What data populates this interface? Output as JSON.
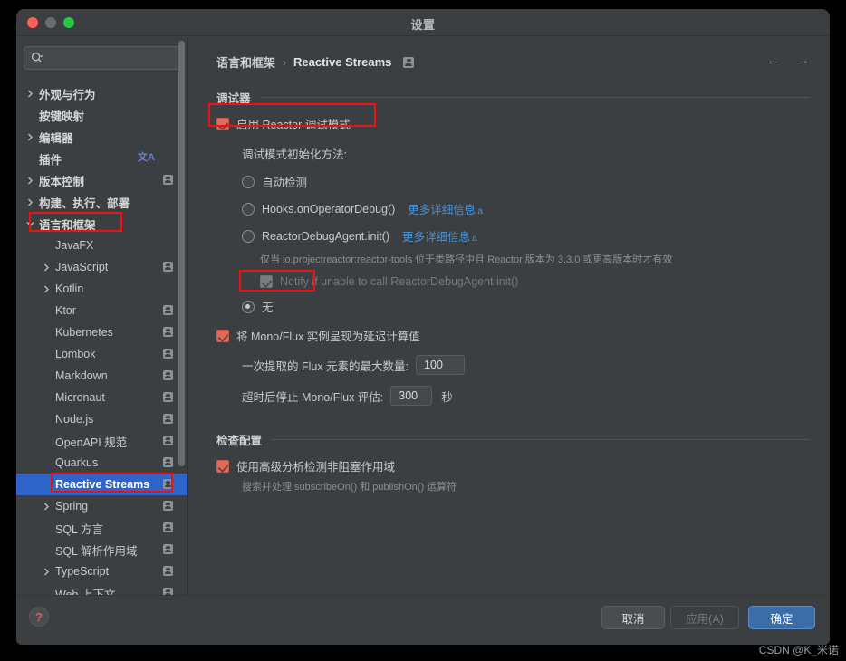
{
  "window": {
    "title": "设置",
    "traffic_lights": [
      "close",
      "minimize",
      "maximize"
    ]
  },
  "sidebar": {
    "search": {
      "value": "",
      "placeholder": ""
    },
    "items": [
      {
        "label": "外观与行为",
        "arrow": "collapsed",
        "indent": 0,
        "bold": true,
        "badge": "none"
      },
      {
        "label": "按键映射",
        "arrow": "none",
        "indent": 0,
        "bold": true,
        "badge": "none"
      },
      {
        "label": "编辑器",
        "arrow": "collapsed",
        "indent": 0,
        "bold": true,
        "badge": "none"
      },
      {
        "label": "插件",
        "arrow": "none",
        "indent": 0,
        "bold": true,
        "badge": "translate"
      },
      {
        "label": "版本控制",
        "arrow": "collapsed",
        "indent": 0,
        "bold": true,
        "badge": "project"
      },
      {
        "label": "构建、执行、部署",
        "arrow": "collapsed",
        "indent": 0,
        "bold": true,
        "badge": "none"
      },
      {
        "label": "语言和框架",
        "arrow": "expanded",
        "indent": 0,
        "bold": true,
        "badge": "none",
        "highlight": true
      },
      {
        "label": "JavaFX",
        "arrow": "none",
        "indent": 1,
        "bold": false,
        "badge": "none"
      },
      {
        "label": "JavaScript",
        "arrow": "collapsed",
        "indent": 1,
        "bold": false,
        "badge": "project"
      },
      {
        "label": "Kotlin",
        "arrow": "collapsed",
        "indent": 1,
        "bold": false,
        "badge": "none"
      },
      {
        "label": "Ktor",
        "arrow": "none",
        "indent": 1,
        "bold": false,
        "badge": "project"
      },
      {
        "label": "Kubernetes",
        "arrow": "none",
        "indent": 1,
        "bold": false,
        "badge": "project"
      },
      {
        "label": "Lombok",
        "arrow": "none",
        "indent": 1,
        "bold": false,
        "badge": "project"
      },
      {
        "label": "Markdown",
        "arrow": "none",
        "indent": 1,
        "bold": false,
        "badge": "project"
      },
      {
        "label": "Micronaut",
        "arrow": "none",
        "indent": 1,
        "bold": false,
        "badge": "project"
      },
      {
        "label": "Node.js",
        "arrow": "none",
        "indent": 1,
        "bold": false,
        "badge": "project"
      },
      {
        "label": "OpenAPI 规范",
        "arrow": "none",
        "indent": 1,
        "bold": false,
        "badge": "project"
      },
      {
        "label": "Quarkus",
        "arrow": "none",
        "indent": 1,
        "bold": false,
        "badge": "project"
      },
      {
        "label": "Reactive Streams",
        "arrow": "none",
        "indent": 1,
        "bold": false,
        "badge": "project",
        "selected": true,
        "highlight": true
      },
      {
        "label": "Spring",
        "arrow": "collapsed",
        "indent": 1,
        "bold": false,
        "badge": "project"
      },
      {
        "label": "SQL 方言",
        "arrow": "none",
        "indent": 1,
        "bold": false,
        "badge": "project"
      },
      {
        "label": "SQL 解析作用域",
        "arrow": "none",
        "indent": 1,
        "bold": false,
        "badge": "project"
      },
      {
        "label": "TypeScript",
        "arrow": "collapsed",
        "indent": 1,
        "bold": false,
        "badge": "project"
      },
      {
        "label": "Web 上下文",
        "arrow": "none",
        "indent": 1,
        "bold": false,
        "badge": "project"
      }
    ]
  },
  "main": {
    "breadcrumb": {
      "parent": "语言和框架",
      "separator": "›",
      "current": "Reactive Streams"
    },
    "nav": {
      "back": "←",
      "forward": "→"
    },
    "debugger_section": {
      "title": "调试器",
      "enable_checkbox": {
        "label": "启用 Reactor 调试模式",
        "checked": true,
        "highlight": true
      },
      "init_method_label": "调试模式初始化方法:",
      "options": [
        {
          "label": "自动检测",
          "selected": false,
          "link": null
        },
        {
          "label": "Hooks.onOperatorDebug()",
          "selected": false,
          "link": "更多详细信息"
        },
        {
          "label": "ReactorDebugAgent.init()",
          "selected": false,
          "link": "更多详细信息"
        }
      ],
      "agent_hint": "仅当 io.projectreactor:reactor-tools 位于类路径中且 Reactor 版本为 3.3.0 或更高版本时才有效",
      "notify_checkbox": {
        "label": "Notify if unable to call ReactorDebugAgent.init()",
        "checked": true,
        "disabled": true
      },
      "none_option": {
        "label": "无",
        "selected": true,
        "highlight": true
      },
      "lazy_checkbox": {
        "label": "将 Mono/Flux 实例呈现为延迟计算值",
        "checked": true
      },
      "max_flux_label": "一次提取的 Flux 元素的最大数量:",
      "max_flux_value": "100",
      "timeout_label": "超时后停止 Mono/Flux 评估:",
      "timeout_value": "300",
      "timeout_unit": "秒"
    },
    "inspection_section": {
      "title": "检查配置",
      "advanced_checkbox": {
        "label": "使用高级分析检测非阻塞作用域",
        "checked": true
      },
      "advanced_hint": "搜索并处理 subscribeOn() 和 publishOn() 运算符"
    }
  },
  "footer": {
    "help": "?",
    "cancel": "取消",
    "apply": "应用(A)",
    "ok": "确定"
  },
  "watermark": "CSDN @K_米诺",
  "colors": {
    "window_bg": "#3c3f41",
    "selection_blue": "#2f65ca",
    "accent_checkbox": "#e06a5e",
    "link_blue": "#4a8fd4",
    "highlight_red": "#ee1111",
    "ok_button_blue": "#3b6ea8"
  }
}
